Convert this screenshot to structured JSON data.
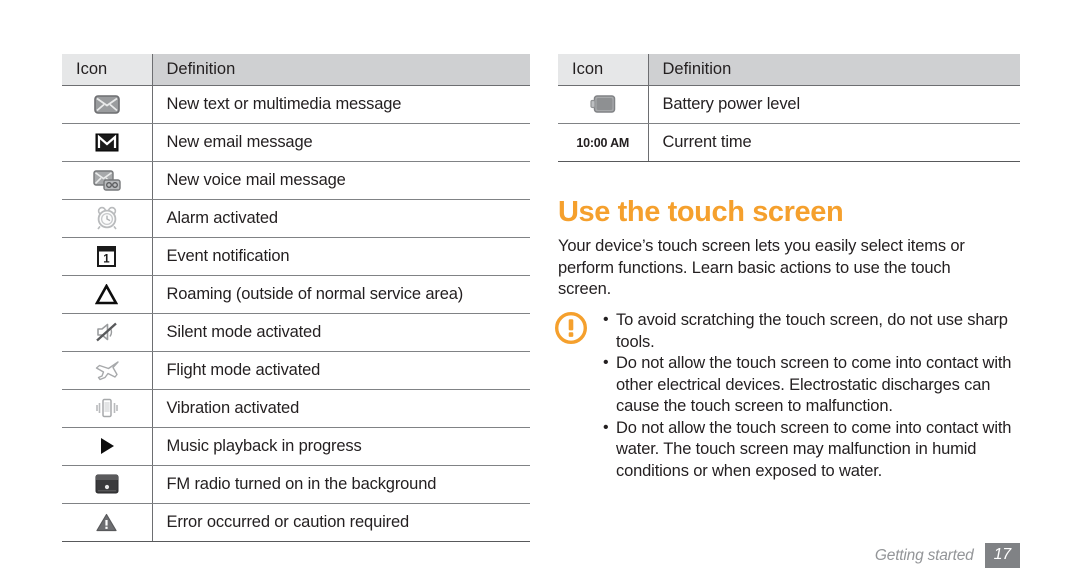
{
  "tables": [
    {
      "id": "indicator-table-left",
      "headers": {
        "icon": "Icon",
        "definition": "Definition"
      },
      "rows": [
        {
          "icon": "envelope-message-icon",
          "definition": "New text or multimedia message"
        },
        {
          "icon": "email-m-icon",
          "definition": "New email message"
        },
        {
          "icon": "voicemail-icon",
          "definition": "New voice mail message"
        },
        {
          "icon": "alarm-clock-icon",
          "definition": "Alarm activated"
        },
        {
          "icon": "calendar-event-icon",
          "definition": "Event notification"
        },
        {
          "icon": "roaming-triangle-icon",
          "definition": "Roaming (outside of normal service area)"
        },
        {
          "icon": "silent-mute-speaker-icon",
          "definition": "Silent mode activated"
        },
        {
          "icon": "airplane-flight-icon",
          "definition": "Flight mode activated"
        },
        {
          "icon": "vibration-phone-icon",
          "definition": "Vibration activated"
        },
        {
          "icon": "music-play-icon",
          "definition": "Music playback in progress"
        },
        {
          "icon": "fm-radio-icon",
          "definition": "FM radio turned on in the background"
        },
        {
          "icon": "warning-triangle-icon",
          "definition": "Error occurred or caution required"
        }
      ]
    },
    {
      "id": "indicator-table-right",
      "headers": {
        "icon": "Icon",
        "definition": "Definition"
      },
      "rows": [
        {
          "icon": "battery-icon",
          "definition": "Battery power level"
        },
        {
          "icon": "clock-time-text",
          "icon_text": "10:00 AM",
          "definition": "Current time"
        }
      ]
    }
  ],
  "section": {
    "heading": "Use the touch screen",
    "intro": "Your device’s touch screen lets you easily select items or perform functions. Learn basic actions to use the touch screen."
  },
  "caution": {
    "icon": "caution-exclamation-circle-icon",
    "bullet_char": "•",
    "items": [
      "To avoid scratching the touch screen, do not use sharp tools.",
      "Do not allow the touch screen to come into contact with other electrical devices. Electrostatic discharges can cause the touch screen to malfunction.",
      "Do not allow the touch screen to come into contact with water. The touch screen may malfunction in humid conditions or when exposed to water."
    ]
  },
  "footer": {
    "section_label": "Getting started",
    "page_number": "17"
  },
  "colors": {
    "accent_orange": "#F5A02D",
    "header_icon_bg": "#E6E7E8",
    "header_def_bg": "#CFD0D2",
    "rule": "#808285",
    "footer_gray": "#808285",
    "text": "#231F20"
  }
}
